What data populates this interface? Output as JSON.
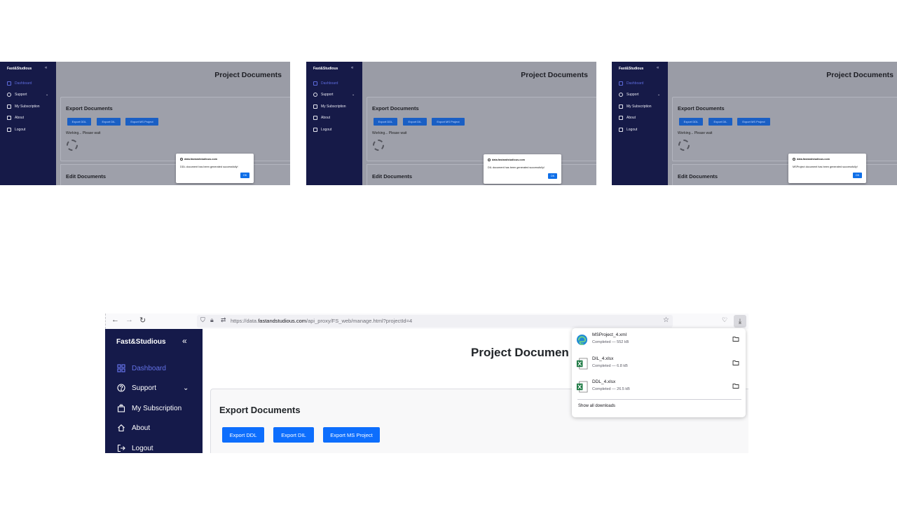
{
  "thumbnails": [
    {
      "sidebar": {
        "brand": "Fast&Studious",
        "collapse": "«",
        "items": [
          "Dashboard",
          "Support",
          "My Subscription",
          "About",
          "Logout"
        ]
      },
      "page_title": "Project Documents",
      "export_title": "Export Documents",
      "buttons": [
        "Export DDL",
        "Export DIL",
        "Export MS Project"
      ],
      "working": "Working... Please wait",
      "edit_title": "Edit Documents",
      "dialog": {
        "domain": "data.fastandstudious.com",
        "message": "DDL document has been generated successfully!",
        "ok": "OK"
      }
    },
    {
      "sidebar": {
        "brand": "Fast&Studious",
        "collapse": "«",
        "items": [
          "Dashboard",
          "Support",
          "My Subscription",
          "About",
          "Logout"
        ]
      },
      "page_title": "Project Documents",
      "export_title": "Export Documents",
      "buttons": [
        "Export DDL",
        "Export DIL",
        "Export MS Project"
      ],
      "working": "Working... Please wait",
      "edit_title": "Edit Documents",
      "dialog": {
        "domain": "data.fastandstudious.com",
        "message": "DIL document has been generated successfully!",
        "ok": "OK"
      }
    },
    {
      "sidebar": {
        "brand": "Fast&Studious",
        "collapse": "«",
        "items": [
          "Dashboard",
          "Support",
          "My Subscription",
          "About",
          "Logout"
        ]
      },
      "page_title": "Project Documents",
      "export_title": "Export Documents",
      "buttons": [
        "Export DDL",
        "Export DIL",
        "Export MS Project"
      ],
      "working": "Working... Please wait",
      "edit_title": "Edit Documents",
      "dialog": {
        "domain": "data.fastandstudious.com",
        "message": "MSProject document has been generated successfully!",
        "ok": "OK"
      }
    }
  ],
  "browser": {
    "url_prefix": "https://data.",
    "url_domain": "fastandstudious.com",
    "url_path": "/api_proxy/FS_web/manage.html?projectId=4",
    "downloads": {
      "items": [
        {
          "name": "MSProject_4.xml",
          "status": "Completed — 552 kB",
          "icon": "edge-icon"
        },
        {
          "name": "DIL_4.xlsx",
          "status": "Completed — 6.8 kB",
          "icon": "excel-icon"
        },
        {
          "name": "DDL_4.xlsx",
          "status": "Completed — 26.5 kB",
          "icon": "excel-icon"
        }
      ],
      "show_all": "Show all downloads"
    }
  },
  "app": {
    "brand": "Fast&Studious",
    "collapse": "«",
    "sidebar": [
      {
        "label": "Dashboard",
        "icon": "dashboard-icon",
        "active": true
      },
      {
        "label": "Support",
        "icon": "question-icon",
        "active": false
      },
      {
        "label": "My Subscription",
        "icon": "subscription-icon",
        "active": false
      },
      {
        "label": "About",
        "icon": "home-icon",
        "active": false
      },
      {
        "label": "Logout",
        "icon": "logout-icon",
        "active": false
      }
    ],
    "support_chevron": "⌄",
    "page_title": "Project Documen",
    "export_title": "Export Documents",
    "buttons": [
      "Export DDL",
      "Export DIL",
      "Export MS Project"
    ]
  }
}
